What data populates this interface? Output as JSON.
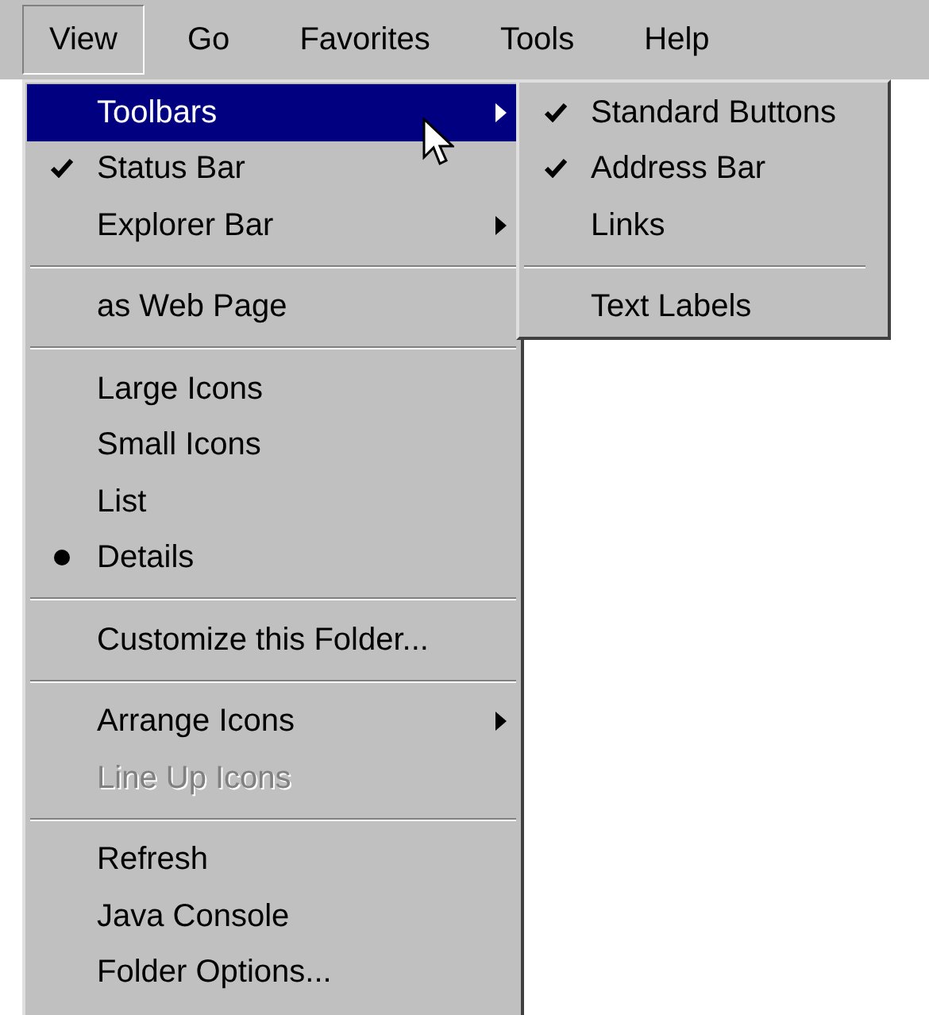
{
  "menubar": [
    {
      "label": "View",
      "selected": true
    },
    {
      "label": "Go",
      "selected": false
    },
    {
      "label": "Favorites",
      "selected": false
    },
    {
      "label": "Tools",
      "selected": false
    },
    {
      "label": "Help",
      "selected": false
    }
  ],
  "menu": [
    {
      "kind": "submenu",
      "label": "Toolbars",
      "selected": true,
      "disabled": false
    },
    {
      "kind": "check",
      "label": "Status Bar",
      "checked": true,
      "selected": false,
      "disabled": false
    },
    {
      "kind": "submenu",
      "label": "Explorer Bar",
      "selected": false,
      "disabled": false
    },
    {
      "kind": "separator"
    },
    {
      "kind": "plain",
      "label": "as Web Page",
      "selected": false,
      "disabled": false
    },
    {
      "kind": "separator"
    },
    {
      "kind": "radio",
      "label": "Large Icons",
      "checked": false,
      "selected": false,
      "disabled": false
    },
    {
      "kind": "radio",
      "label": "Small Icons",
      "checked": false,
      "selected": false,
      "disabled": false
    },
    {
      "kind": "radio",
      "label": "List",
      "checked": false,
      "selected": false,
      "disabled": false
    },
    {
      "kind": "radio",
      "label": "Details",
      "checked": true,
      "selected": false,
      "disabled": false
    },
    {
      "kind": "separator"
    },
    {
      "kind": "plain",
      "label": "Customize this Folder...",
      "selected": false,
      "disabled": false
    },
    {
      "kind": "separator"
    },
    {
      "kind": "submenu",
      "label": "Arrange Icons",
      "selected": false,
      "disabled": false
    },
    {
      "kind": "plain",
      "label": "Line Up Icons",
      "selected": false,
      "disabled": true
    },
    {
      "kind": "separator"
    },
    {
      "kind": "plain",
      "label": "Refresh",
      "selected": false,
      "disabled": false
    },
    {
      "kind": "plain",
      "label": "Java Console",
      "selected": false,
      "disabled": false
    },
    {
      "kind": "plain",
      "label": "Folder Options...",
      "selected": false,
      "disabled": false
    }
  ],
  "submenu": [
    {
      "kind": "check",
      "label": "Standard Buttons",
      "checked": true,
      "selected": false,
      "disabled": false
    },
    {
      "kind": "check",
      "label": "Address Bar",
      "checked": true,
      "selected": false,
      "disabled": false
    },
    {
      "kind": "check",
      "label": "Links",
      "checked": false,
      "selected": false,
      "disabled": false
    },
    {
      "kind": "separator"
    },
    {
      "kind": "check",
      "label": "Text Labels",
      "checked": false,
      "selected": false,
      "disabled": false
    }
  ]
}
